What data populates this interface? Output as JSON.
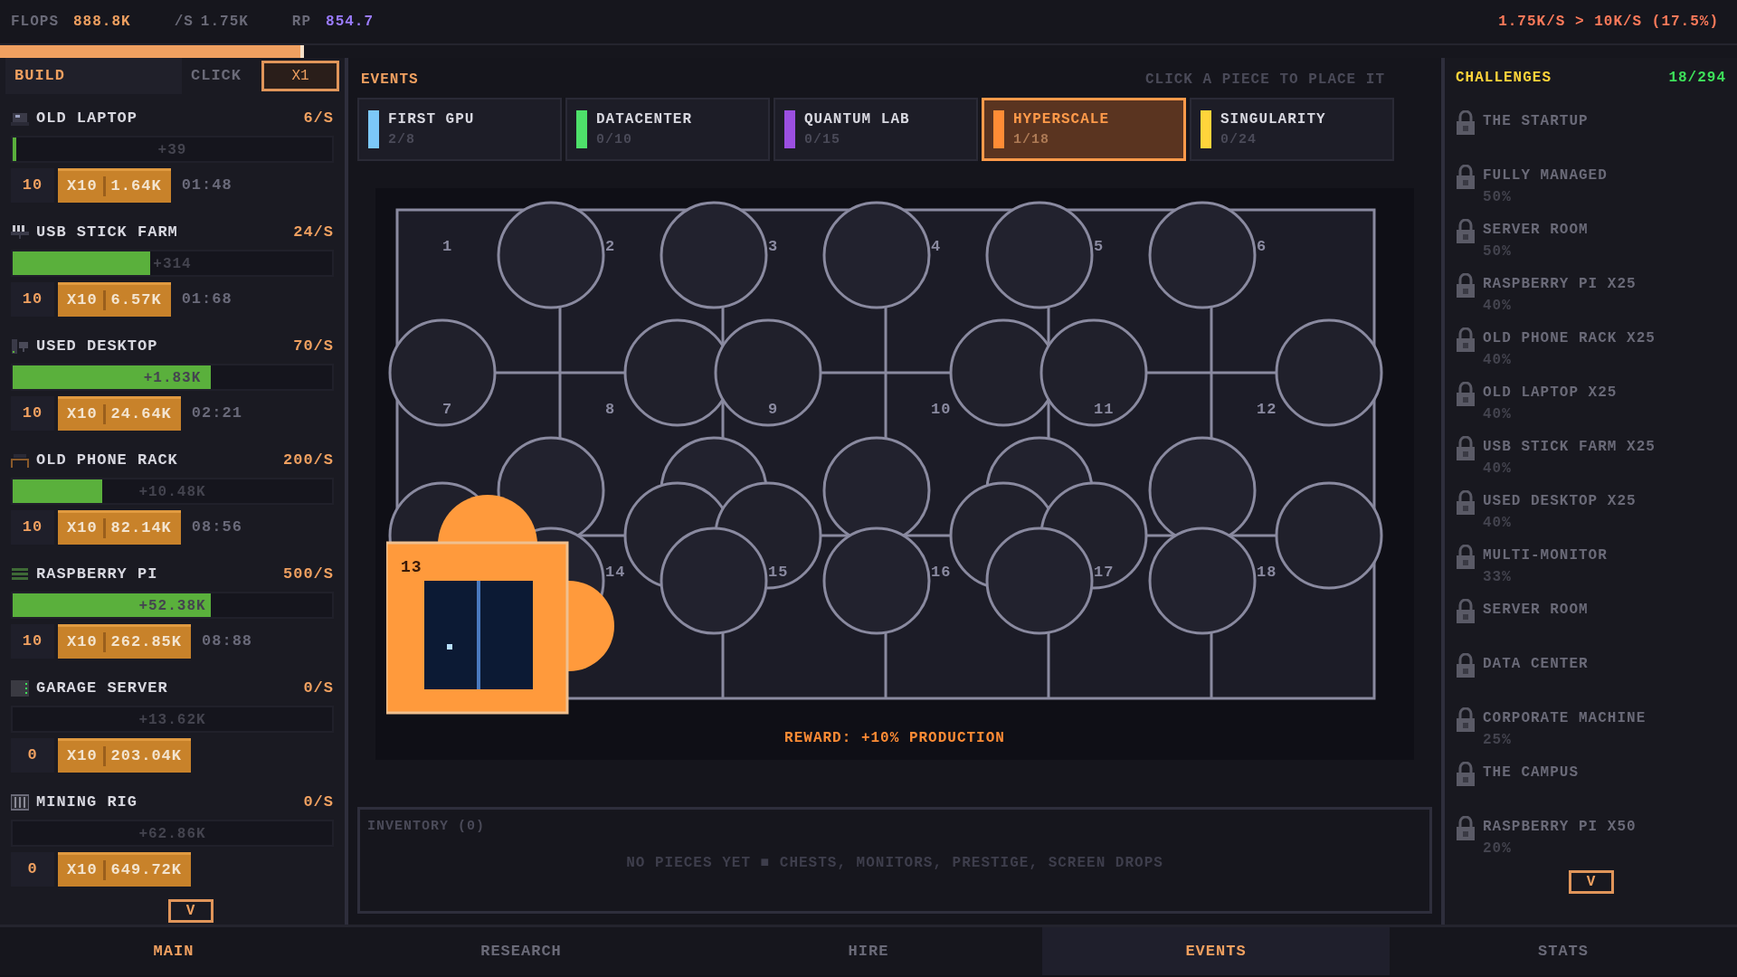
{
  "top_bar": {
    "flops_label": "FLOPS",
    "flops": "888.8K",
    "rate_label": "/S",
    "rate": "1.75K",
    "rp_label": "RP",
    "rp": "854.7",
    "goal": "1.75K/S > 10K/S (17.5%)"
  },
  "goal_progress": {
    "level": 0.175
  },
  "build_panel": {
    "tabs": [
      {
        "label": "BUILD",
        "selected": true
      },
      {
        "label": "CLICK",
        "selected": false
      }
    ],
    "multiplier": "X1",
    "items": [
      {
        "name": "OLD LAPTOP",
        "rate": "6/S",
        "level": 0.01,
        "gain": "+39",
        "owned": "10",
        "buy_qty": "X10",
        "cost": "1.64K",
        "timer": "01:48"
      },
      {
        "name": "USB STICK FARM",
        "rate": "24/S",
        "level": 0.43,
        "gain": "+314",
        "owned": "10",
        "buy_qty": "X10",
        "cost": "6.57K",
        "timer": "01:68"
      },
      {
        "name": "USED DESKTOP",
        "rate": "70/S",
        "level": 0.62,
        "gain": "+1.83K",
        "owned": "10",
        "buy_qty": "X10",
        "cost": "24.64K",
        "timer": "02:21"
      },
      {
        "name": "OLD PHONE RACK",
        "rate": "200/S",
        "level": 0.28,
        "gain": "+10.48K",
        "owned": "10",
        "buy_qty": "X10",
        "cost": "82.14K",
        "timer": "08:56"
      },
      {
        "name": "RASPBERRY PI",
        "rate": "500/S",
        "level": 0.62,
        "gain": "+52.38K",
        "owned": "10",
        "buy_qty": "X10",
        "cost": "262.85K",
        "timer": "08:88"
      },
      {
        "name": "GARAGE SERVER",
        "rate": "0/S",
        "level": 0,
        "gain": "+13.62K",
        "owned": "0",
        "buy_qty": "X10",
        "cost": "203.04K"
      },
      {
        "name": "MINING RIG",
        "rate": "0/S",
        "level": 0,
        "gain": "+62.86K",
        "owned": "0",
        "buy_qty": "X10",
        "cost": "649.72K"
      }
    ],
    "scroll": "V"
  },
  "events": {
    "title": "EVENTS",
    "hint": "CLICK A PIECE TO PLACE IT",
    "tabs": [
      {
        "name": "FIRST GPU",
        "progress": "2/8",
        "color": "#7cc8f8",
        "selected": false
      },
      {
        "name": "DATACENTER",
        "progress": "0/10",
        "color": "#4ee06a",
        "selected": false
      },
      {
        "name": "QUANTUM LAB",
        "progress": "0/15",
        "color": "#9b4fe0",
        "selected": false
      },
      {
        "name": "HYPERSCALE",
        "progress": "1/18",
        "color": "#ff8c35",
        "selected": true
      },
      {
        "name": "SINGULARITY",
        "progress": "0/24",
        "color": "#ffd43b",
        "selected": false
      }
    ],
    "board": {
      "slots": [
        {
          "number": "1",
          "filled": false
        },
        {
          "number": "2",
          "filled": false
        },
        {
          "number": "3",
          "filled": false
        },
        {
          "number": "4",
          "filled": false
        },
        {
          "number": "5",
          "filled": false
        },
        {
          "number": "6",
          "filled": false
        },
        {
          "number": "7",
          "filled": false
        },
        {
          "number": "8",
          "filled": false
        },
        {
          "number": "9",
          "filled": false
        },
        {
          "number": "10",
          "filled": false
        },
        {
          "number": "11",
          "filled": false
        },
        {
          "number": "12",
          "filled": false
        },
        {
          "number": "13",
          "filled": true
        },
        {
          "number": "14",
          "filled": false
        },
        {
          "number": "15",
          "filled": false
        },
        {
          "number": "16",
          "filled": false
        },
        {
          "number": "17",
          "filled": false
        },
        {
          "number": "18",
          "filled": false
        }
      ]
    },
    "reward": "REWARD: +10% PRODUCTION"
  },
  "inventory": {
    "title": "INVENTORY (0)",
    "empty_text": "NO PIECES YET ■ CHESTS, MONITORS, PRESTIGE, SCREEN DROPS"
  },
  "challenges": {
    "title": "CHALLENGES",
    "count": "18/294",
    "items": [
      {
        "name": "THE STARTUP",
        "locked": true
      },
      {
        "name": "FULLY MANAGED",
        "progress": "50%",
        "locked": true
      },
      {
        "name": "SERVER ROOM",
        "progress": "50%",
        "locked": true
      },
      {
        "name": "RASPBERRY PI X25",
        "progress": "40%",
        "locked": true
      },
      {
        "name": "OLD PHONE RACK X25",
        "progress": "40%",
        "locked": true
      },
      {
        "name": "OLD LAPTOP X25",
        "progress": "40%",
        "locked": true
      },
      {
        "name": "USB STICK FARM X25",
        "progress": "40%",
        "locked": true
      },
      {
        "name": "USED DESKTOP X25",
        "progress": "40%",
        "locked": true
      },
      {
        "name": "MULTI-MONITOR",
        "progress": "33%",
        "locked": true
      },
      {
        "name": "SERVER ROOM",
        "locked": true
      },
      {
        "name": "DATA CENTER",
        "locked": true
      },
      {
        "name": "CORPORATE MACHINE",
        "progress": "25%",
        "locked": true
      },
      {
        "name": "THE CAMPUS",
        "locked": true
      },
      {
        "name": "RASPBERRY PI X50",
        "progress": "20%",
        "locked": true
      }
    ],
    "scroll": "V"
  },
  "bottom_nav": [
    {
      "label": "MAIN",
      "selected": false,
      "emphasized": true
    },
    {
      "label": "RESEARCH",
      "selected": false,
      "emphasized": false
    },
    {
      "label": "HIRE",
      "selected": false,
      "emphasized": false
    },
    {
      "label": "EVENTS",
      "selected": true,
      "emphasized": true
    },
    {
      "label": "STATS",
      "selected": false,
      "emphasized": false
    }
  ]
}
